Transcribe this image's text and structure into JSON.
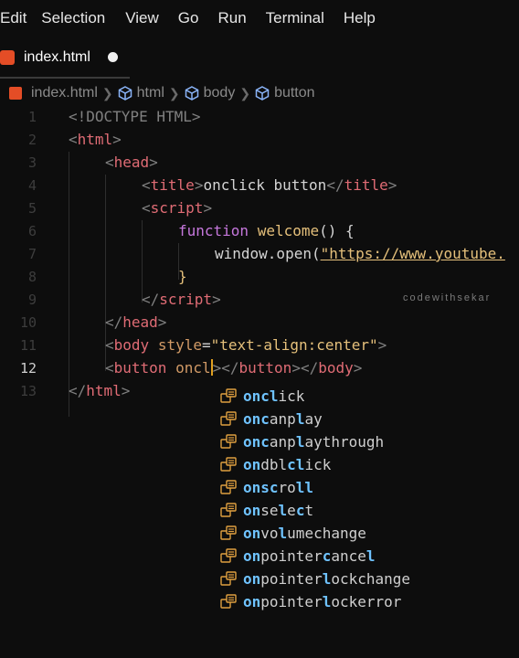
{
  "menu": [
    "Edit",
    "Selection",
    "View",
    "Go",
    "Run",
    "Terminal",
    "Help"
  ],
  "tab": {
    "label": "index.html"
  },
  "breadcrumb": {
    "file": "index.html",
    "items": [
      "html",
      "body",
      "button"
    ]
  },
  "lines": [
    {
      "n": "1"
    },
    {
      "n": "2"
    },
    {
      "n": "3"
    },
    {
      "n": "4"
    },
    {
      "n": "5"
    },
    {
      "n": "6"
    },
    {
      "n": "7"
    },
    {
      "n": "8"
    },
    {
      "n": "9"
    },
    {
      "n": "10"
    },
    {
      "n": "11"
    },
    {
      "n": "12"
    },
    {
      "n": "13"
    }
  ],
  "code": {
    "l1_doctype": "<!DOCTYPE HTML>",
    "l2_tag": "html",
    "l3_tag": "head",
    "l4_tag_open": "title",
    "l4_text": "onclick button",
    "l4_tag_close": "title",
    "l5_tag": "script",
    "l6_kw": "function",
    "l6_fn": "welcome",
    "l6_rest": "() {",
    "l7_obj": "window.open(",
    "l7_url": "\"https://www.youtube.",
    "l8_brace": "}",
    "l9_tag": "script",
    "l10_tag": "head",
    "l11_tag": "body",
    "l11_attr": "style",
    "l11_val": "\"text-align:center\"",
    "l12_tag": "button",
    "l12_typed": "oncl",
    "l12_close1": "button",
    "l12_close2": "body",
    "l13_tag": "html"
  },
  "watermark": "codewithsekar",
  "suggestions": [
    {
      "hl": "oncl",
      "rest": "ick"
    },
    {
      "hl": "onc",
      "rest": "anp",
      "hl2": "l",
      "rest2": "ay"
    },
    {
      "hl": "onc",
      "rest": "anp",
      "hl2": "l",
      "rest2": "aythrough"
    },
    {
      "hl": "on",
      "rest": "dbl",
      "hl2": "cl",
      "rest2": "ick"
    },
    {
      "hl": "onsc",
      "rest": "ro",
      "hl2": "ll",
      "rest2": ""
    },
    {
      "hl": "on",
      "rest": "se",
      "hl2": "l",
      "rest2": "e",
      "hl3": "c",
      "rest3": "t"
    },
    {
      "hl": "on",
      "rest": "vo",
      "hl2": "l",
      "rest2": "umechange"
    },
    {
      "hl": "on",
      "rest": "pointer",
      "hl2": "c",
      "rest2": "ance",
      "hl3": "l",
      "rest3": ""
    },
    {
      "hl": "on",
      "rest": "pointer",
      "hl2": "l",
      "rest2": "ockchange"
    },
    {
      "hl": "on",
      "rest": "pointer",
      "hl2": "l",
      "rest2": "ockerror"
    }
  ],
  "colors": {
    "background": "#0d0d0d",
    "tag": "#e06c75",
    "string": "#e5c07b",
    "keyword": "#c678dd",
    "match": "#6fc3ff",
    "cursor": "#e0a020"
  }
}
